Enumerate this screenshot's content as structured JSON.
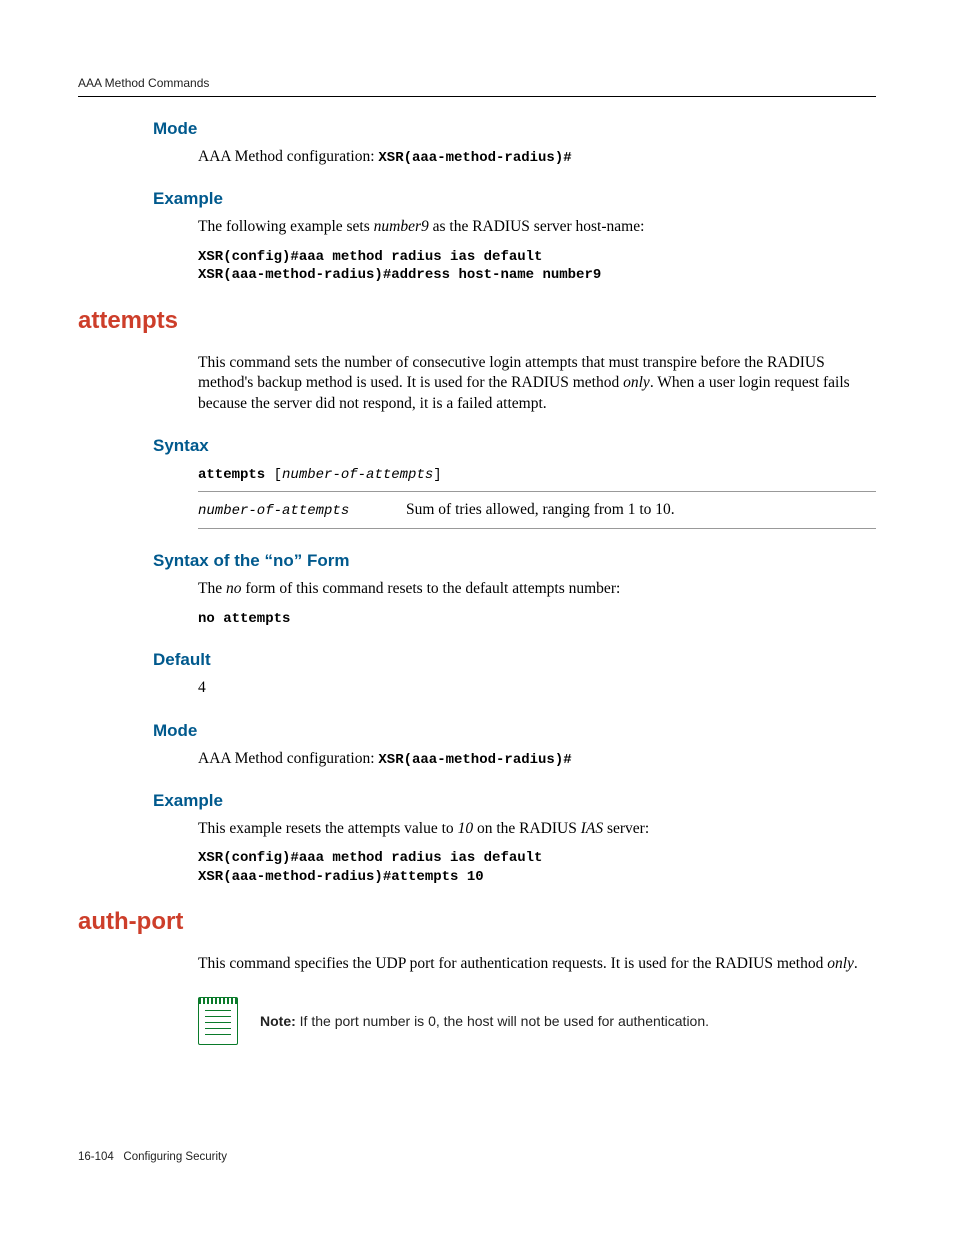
{
  "header": {
    "running": "AAA Method Commands"
  },
  "sec1": {
    "mode_h": "Mode",
    "mode_text_pre": "AAA Method configuration: ",
    "mode_prompt": "XSR(aaa-method-radius)#",
    "example_h": "Example",
    "example_intro_a": "The following example sets ",
    "example_intro_i": "number9",
    "example_intro_b": " as the RADIUS server host-name:",
    "example_code1": "XSR(config)#aaa method radius ias default",
    "example_code2": "XSR(aaa-method-radius)#address host-name number9"
  },
  "attempts": {
    "title": "attempts",
    "desc_a": "This command sets the number of consecutive login attempts that must transpire before the RADIUS method's backup method is used. It is used for the RADIUS method ",
    "desc_i": "only",
    "desc_b": ". When a user login request fails because the server did not respond, it is a failed attempt.",
    "syntax_h": "Syntax",
    "syntax_cmd": "attempts ",
    "syntax_open": "[",
    "syntax_param": "number-of-attempts",
    "syntax_close": "]",
    "param_name": "number-of-attempts",
    "param_desc": "Sum of tries allowed, ranging from 1 to 10.",
    "noform_h": "Syntax of the “no” Form",
    "noform_text_a": "The ",
    "noform_text_i": "no",
    "noform_text_b": " form of this command resets to the default attempts number:",
    "noform_code": "no attempts",
    "default_h": "Default",
    "default_val": "4",
    "mode_h": "Mode",
    "mode_text_pre": "AAA Method configuration: ",
    "mode_prompt": "XSR(aaa-method-radius)#",
    "example_h": "Example",
    "example_intro_a": "This example resets the attempts value to ",
    "example_intro_i": "10",
    "example_intro_b": " on the RADIUS ",
    "example_intro_i2": "IAS",
    "example_intro_c": " server:",
    "example_code1": "XSR(config)#aaa method radius ias default",
    "example_code2": "XSR(aaa-method-radius)#attempts 10"
  },
  "authport": {
    "title": "auth-port",
    "desc_a": "This command specifies the UDP port for authentication requests. It is used for the RADIUS method ",
    "desc_i": "only",
    "desc_b": ".",
    "note_label": "Note:",
    "note_text": " If the port number is 0, the host will not be used for authentication."
  },
  "footer": {
    "pageno": "16-104",
    "section": "Configuring Security"
  }
}
